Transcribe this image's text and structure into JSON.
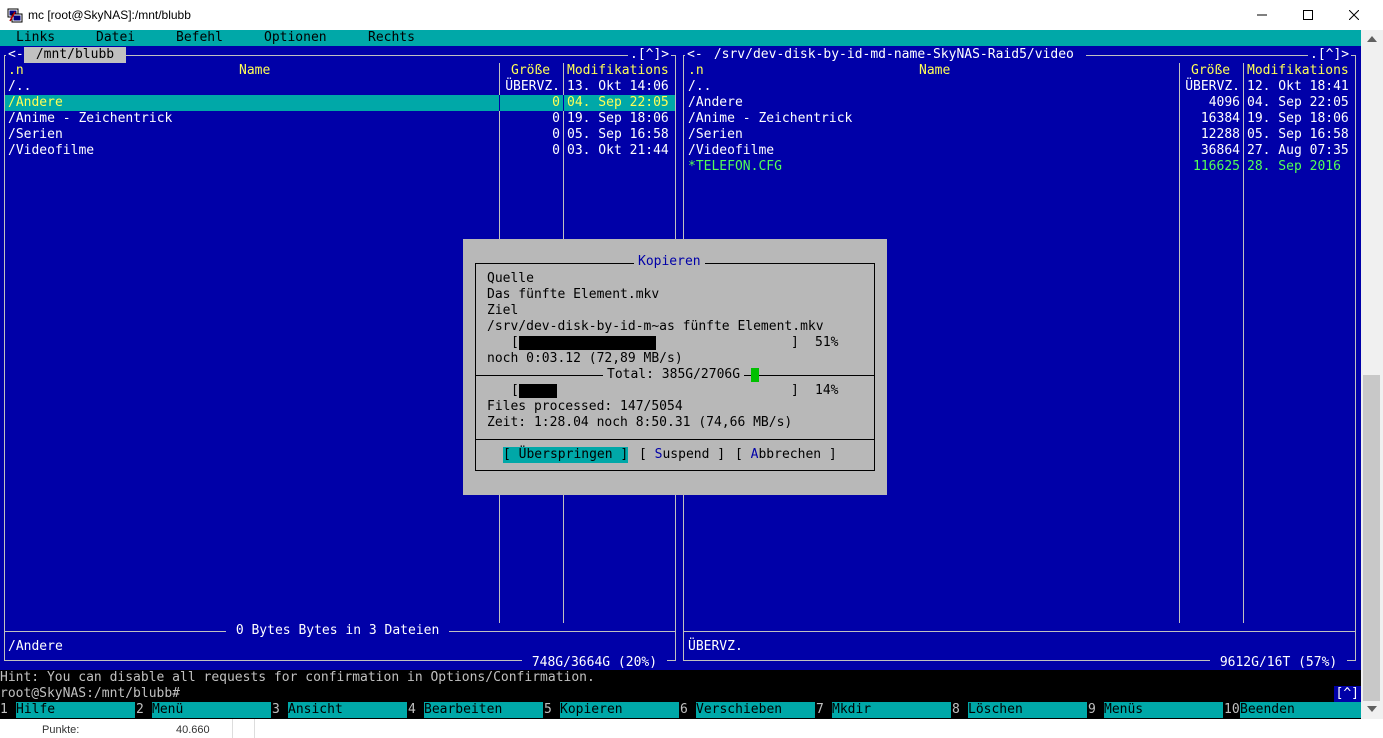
{
  "window": {
    "title": "mc [root@SkyNAS]:/mnt/blubb"
  },
  "menubar": [
    "Links",
    "Datei",
    "Befehl",
    "Optionen",
    "Rechts"
  ],
  "left_panel": {
    "path": " /mnt/blubb ",
    "left_corner": "<-",
    "right_corner": ".[^]>",
    "headers": {
      "name_sort": ".n",
      "name": "Name",
      "size": "Größe",
      "mtime": "Modifikations"
    },
    "rows": [
      {
        "name": "/..",
        "size": "ÜBERVZ.",
        "mtime": "13. Okt 14:06"
      },
      {
        "name": "/Andere",
        "size": "0",
        "mtime": "04. Sep 22:05"
      },
      {
        "name": "/Anime - Zeichentrick",
        "size": "0",
        "mtime": "19. Sep 18:06"
      },
      {
        "name": "/Serien",
        "size": "0",
        "mtime": "05. Sep 16:58"
      },
      {
        "name": "/Videofilme",
        "size": "0",
        "mtime": "03. Okt 21:44"
      }
    ],
    "summary": " 0 Bytes Bytes in 3 Dateien ",
    "mini_status": "/Andere",
    "disk": " 748G/3664G (20%) "
  },
  "right_panel": {
    "path": " /srv/dev-disk-by-id-md-name-SkyNAS-Raid5/video ",
    "left_corner": "<-",
    "right_corner": ".[^]>",
    "headers": {
      "name_sort": ".n",
      "name": "Name",
      "size": "Größe",
      "mtime": "Modifikations"
    },
    "rows": [
      {
        "name": "/..",
        "size": "ÜBERVZ.",
        "mtime": "12. Okt 18:41"
      },
      {
        "name": "/Andere",
        "size": "4096",
        "mtime": "04. Sep 22:05"
      },
      {
        "name": "/Anime - Zeichentrick",
        "size": "16384",
        "mtime": "19. Sep 18:06"
      },
      {
        "name": "/Serien",
        "size": "12288",
        "mtime": "05. Sep 16:58"
      },
      {
        "name": "/Videofilme",
        "size": "36864",
        "mtime": "27. Aug 07:35"
      },
      {
        "name": "*TELEFON.CFG",
        "size": "116625",
        "mtime": "28. Sep 2016"
      }
    ],
    "mini_status": "ÜBERVZ.",
    "disk": " 9612G/16T (57%) "
  },
  "dialog": {
    "title": "Kopieren",
    "source_label": "Quelle",
    "source_file": "Das fünfte Element.mkv",
    "target_label": "Ziel",
    "target_path": "/srv/dev-disk-by-id-m~as fünfte Element.mkv",
    "file_bar_left": "[",
    "file_bar_right": "]",
    "file_progress": 0.51,
    "file_percent": "51%",
    "file_eta": "noch 0:03.12 (72,89 MB/s)",
    "total_label": "Total: 385G/2706G",
    "total_progress": 0.14,
    "total_percent": "14%",
    "files_processed": "Files processed: 147/5054",
    "time": "Zeit: 1:28.04 noch 8:50.31 (74,66 MB/s)",
    "buttons": {
      "skip": "[ Überspringen ]",
      "suspend_open": "[ ",
      "suspend_hot": "S",
      "suspend_rest": "uspend ]",
      "abort_open": "[ ",
      "abort_hot": "A",
      "abort_rest": "bbrechen ]"
    },
    "colors": {
      "total_indicator": "#00c000"
    }
  },
  "hint": "Hint: You can disable all requests for confirmation in Options/Confirmation.",
  "prompt": "root@SkyNAS:/mnt/blubb#",
  "prompt_flag": "[^]",
  "fkeys": [
    {
      "num": "1",
      "label": "Hilfe"
    },
    {
      "num": "2",
      "label": "Menü"
    },
    {
      "num": "3",
      "label": "Ansicht"
    },
    {
      "num": "4",
      "label": "Bearbeiten"
    },
    {
      "num": "5",
      "label": "Kopieren"
    },
    {
      "num": "6",
      "label": "Verschieben"
    },
    {
      "num": "7",
      "label": "Mkdir"
    },
    {
      "num": "8",
      "label": "Löschen"
    },
    {
      "num": "9",
      "label": "Menüs"
    },
    {
      "num": "10",
      "label": "Beenden"
    }
  ],
  "statusbar": {
    "label": "Punkte:",
    "value": "40.660"
  },
  "colors": {
    "terminal_bg": "#0000a8",
    "cyan": "#00a8a8",
    "header_yellow": "#ffff55",
    "exec_green": "#55ff55"
  }
}
